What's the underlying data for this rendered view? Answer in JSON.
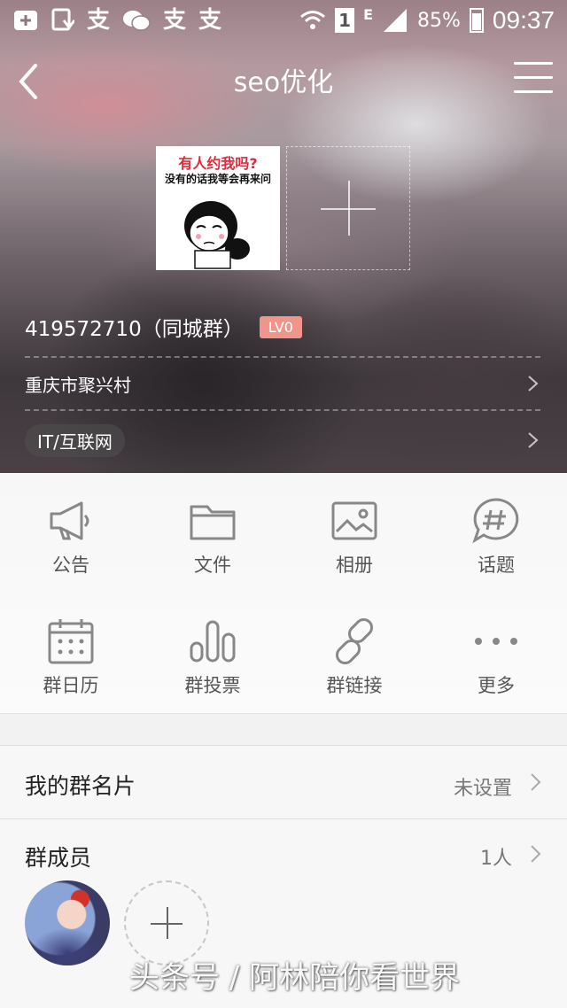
{
  "status_bar": {
    "left_icons": [
      "add-box-icon",
      "download-icon",
      "alipay-icon",
      "wechat-icon",
      "alipay-icon",
      "alipay-icon"
    ],
    "alipay_glyph": "支",
    "sim_slot": "1",
    "network_type": "E",
    "battery": "85%",
    "time": "09:37"
  },
  "nav": {
    "title": "seo优化"
  },
  "avatar": {
    "line1": "有人约我吗?",
    "line2": "没有的话我等会再来问"
  },
  "group": {
    "id_text": "419572710（同城群）",
    "level": "LV0",
    "location": "重庆市聚兴村",
    "category": "IT/互联网"
  },
  "features": [
    {
      "label": "公告",
      "icon": "megaphone-icon"
    },
    {
      "label": "文件",
      "icon": "folder-icon"
    },
    {
      "label": "相册",
      "icon": "image-icon"
    },
    {
      "label": "话题",
      "icon": "topic-bubble-icon"
    },
    {
      "label": "群日历",
      "icon": "calendar-icon"
    },
    {
      "label": "群投票",
      "icon": "vote-bars-icon"
    },
    {
      "label": "群链接",
      "icon": "link-icon"
    },
    {
      "label": "更多",
      "icon": "more-dots-icon"
    }
  ],
  "card": {
    "title": "我的群名片",
    "value": "未设置"
  },
  "members": {
    "title": "群成员",
    "count": "1人"
  },
  "watermark": "头条号 / 阿林陪你看世界"
}
